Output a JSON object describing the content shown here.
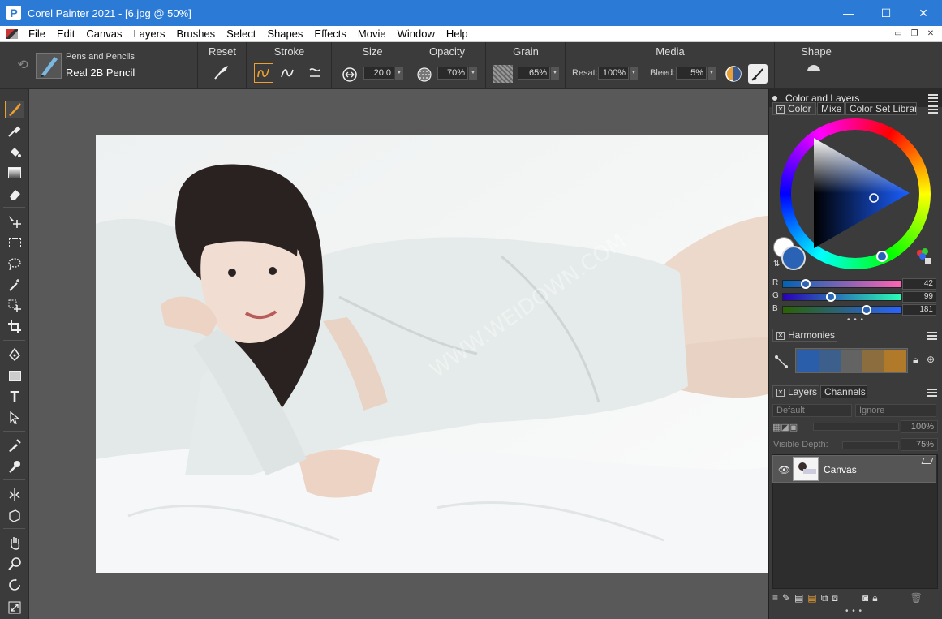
{
  "window": {
    "title": "Corel Painter 2021 - [6.jpg @ 50%]",
    "logo_letter": "P",
    "controls": {
      "minimize": "—",
      "maximize": "☐",
      "close": "✕"
    }
  },
  "menubar": {
    "items": [
      "File",
      "Edit",
      "Canvas",
      "Layers",
      "Brushes",
      "Select",
      "Shapes",
      "Effects",
      "Movie",
      "Window",
      "Help"
    ],
    "mdi": {
      "minimize": "▭",
      "restore": "❐",
      "close": "✕"
    }
  },
  "propbar": {
    "brush_category": "Pens and Pencils",
    "brush_variant": "Real 2B Pencil",
    "reset_label": "Reset",
    "stroke_label": "Stroke",
    "size_label": "Size",
    "size_value": "20.0",
    "opacity_label": "Opacity",
    "opacity_value": "70%",
    "grain_label": "Grain",
    "grain_value": "65%",
    "media_label": "Media",
    "resat_label": "Resat:",
    "resat_value": "100%",
    "bleed_label": "Bleed:",
    "bleed_value": "5%",
    "shape_label": "Shape"
  },
  "panels": {
    "group_title": "Color and Layers",
    "color_tabs": [
      "Color",
      "Mixe",
      "Color Set Librar"
    ],
    "rgb": {
      "r_label": "R",
      "r_value": "42",
      "g_label": "G",
      "g_value": "99",
      "b_label": "B",
      "b_value": "181",
      "r_fraction": 0.165,
      "g_fraction": 0.388,
      "b_fraction": 0.71
    },
    "main_color": "#2a63b5",
    "secondary_color": "#ffffff",
    "harmonies_title": "Harmonies",
    "harmony_colors": [
      "#2a5eaa",
      "#3d5f8c",
      "#636363",
      "#8c6d3d",
      "#b07a2a"
    ],
    "layers_tabs": [
      "Layers",
      "Channels"
    ],
    "composite_method": "Default",
    "composite_depth": "Ignore",
    "layer_opacity": "100%",
    "visible_depth_label": "Visible Depth:",
    "visible_depth_value": "75%",
    "layer_name": "Canvas"
  }
}
